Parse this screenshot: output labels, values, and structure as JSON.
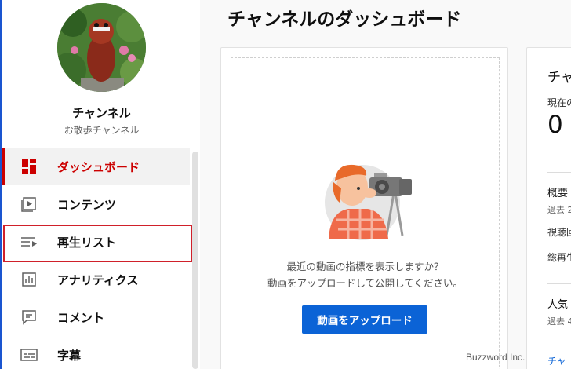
{
  "sidebar": {
    "channel_name": "チャンネル",
    "channel_subtitle": "お散歩チャンネル",
    "items": [
      {
        "label": "ダッシュボード",
        "icon": "dashboard-icon"
      },
      {
        "label": "コンテンツ",
        "icon": "content-icon"
      },
      {
        "label": "再生リスト",
        "icon": "playlist-icon"
      },
      {
        "label": "アナリティクス",
        "icon": "analytics-icon"
      },
      {
        "label": "コメント",
        "icon": "comment-icon"
      },
      {
        "label": "字幕",
        "icon": "subtitles-icon"
      }
    ]
  },
  "main": {
    "title": "チャンネルのダッシュボード",
    "upload_card": {
      "line1": "最近の動画の指標を表示しますか？",
      "line2": "動画をアップロードして公開してください。",
      "button": "動画をアップロード"
    },
    "analytics_card": {
      "title": "チャ",
      "current": "現在の",
      "value": "0",
      "summary": "概要",
      "past": "過去 2",
      "views": "視聴回",
      "total": "総再生",
      "popular": "人気",
      "past2": "過去 4",
      "link": "チャ"
    }
  },
  "watermark": "Buzzword Inc.",
  "colors": {
    "accent_red": "#cc0000",
    "button_blue": "#0b63d6",
    "highlight_border": "#d0202a"
  }
}
